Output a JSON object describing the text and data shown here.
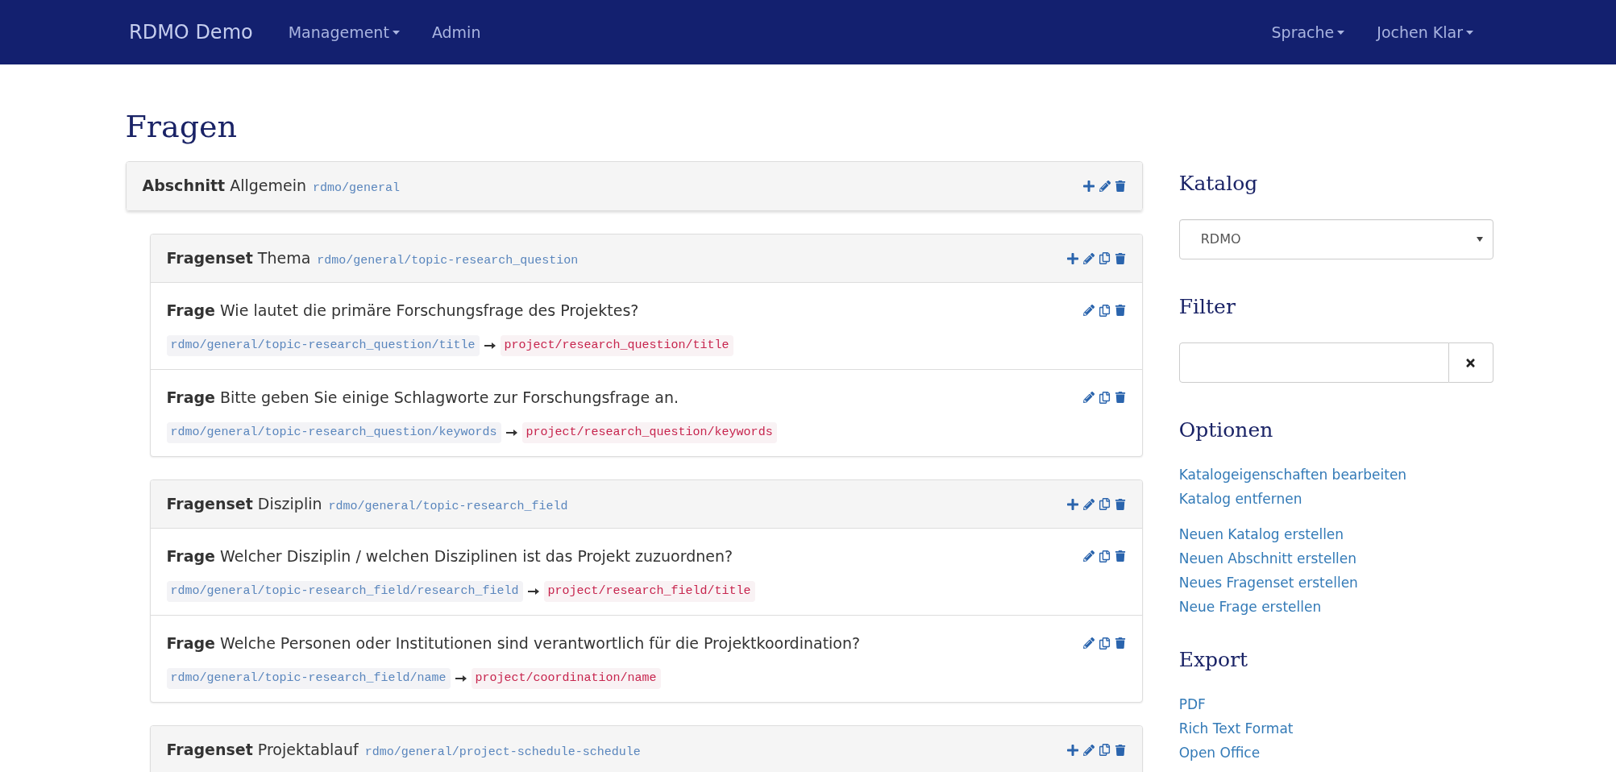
{
  "navbar": {
    "brand": "RDMO Demo",
    "left_menu": [
      {
        "label": "Management",
        "dropdown": true
      },
      {
        "label": "Admin",
        "dropdown": false
      }
    ],
    "right_menu": [
      {
        "label": "Sprache",
        "dropdown": true
      },
      {
        "label": "Jochen Klar",
        "dropdown": true
      }
    ]
  },
  "title": "Fragen",
  "section": {
    "type_label": "Abschnitt",
    "title": "Allgemein",
    "uri": "rdmo/general"
  },
  "questionsets": [
    {
      "type_label": "Fragenset",
      "title": "Thema",
      "uri": "rdmo/general/topic-research_question",
      "questions": [
        {
          "type_label": "Frage",
          "text": "Wie lautet die primäre Forschungsfrage des Projektes?",
          "uri": "rdmo/general/topic-research_question/title",
          "attribute": "project/research_question/title"
        },
        {
          "type_label": "Frage",
          "text": "Bitte geben Sie einige Schlagworte zur Forschungsfrage an.",
          "uri": "rdmo/general/topic-research_question/keywords",
          "attribute": "project/research_question/keywords"
        }
      ]
    },
    {
      "type_label": "Fragenset",
      "title": "Disziplin",
      "uri": "rdmo/general/topic-research_field",
      "questions": [
        {
          "type_label": "Frage",
          "text": "Welcher Disziplin / welchen Disziplinen ist das Projekt zuzuordnen?",
          "uri": "rdmo/general/topic-research_field/research_field",
          "attribute": "project/research_field/title"
        },
        {
          "type_label": "Frage",
          "text": "Welche Personen oder Institutionen sind verantwortlich für die Projektkoordination?",
          "uri": "rdmo/general/topic-research_field/name",
          "attribute": "project/coordination/name"
        }
      ]
    },
    {
      "type_label": "Fragenset",
      "title": "Projektablauf",
      "uri": "rdmo/general/project-schedule-schedule"
    }
  ],
  "sidebar": {
    "catalog": {
      "heading": "Katalog",
      "value": "RDMO"
    },
    "filter": {
      "heading": "Filter"
    },
    "options": {
      "heading": "Optionen",
      "groups": [
        [
          "Katalogeigenschaften bearbeiten",
          "Katalog entfernen"
        ],
        [
          "Neuen Katalog erstellen",
          "Neuen Abschnitt erstellen",
          "Neues Fragenset erstellen",
          "Neue Frage erstellen"
        ]
      ]
    },
    "export": {
      "heading": "Export",
      "links": [
        "PDF",
        "Rich Text Format",
        "Open Office"
      ]
    }
  }
}
